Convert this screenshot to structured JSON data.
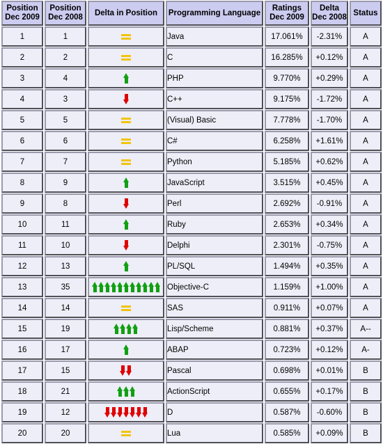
{
  "table": {
    "columns": [
      {
        "key": "pos2009",
        "line1": "Position",
        "line2": "Dec 2009"
      },
      {
        "key": "pos2008",
        "line1": "Position",
        "line2": "Dec 2008"
      },
      {
        "key": "delta_pos",
        "line1": "Delta in Position",
        "line2": ""
      },
      {
        "key": "language",
        "line1": "Programming Language",
        "line2": ""
      },
      {
        "key": "ratings",
        "line1": "Ratings",
        "line2": "Dec 2009"
      },
      {
        "key": "delta",
        "line1": "Delta",
        "line2": "Dec 2008"
      },
      {
        "key": "status",
        "line1": "Status",
        "line2": ""
      }
    ],
    "icons": {
      "up": "arrow-up-icon",
      "down": "arrow-down-icon",
      "equal": "equals-icon"
    },
    "colors": {
      "header_bg": "#ccccf0",
      "cell_bg": "#eeeef8",
      "border": "#9a9aad",
      "language_text": "#3333aa",
      "arrow_up": "#11a011",
      "arrow_down": "#e00000",
      "equals": "#f2c40a"
    },
    "rows": [
      {
        "pos2009": "1",
        "pos2008": "1",
        "delta_dir": "equal",
        "delta_count": 1,
        "language": "Java",
        "ratings": "17.061%",
        "delta": "-2.31%",
        "status": "A"
      },
      {
        "pos2009": "2",
        "pos2008": "2",
        "delta_dir": "equal",
        "delta_count": 1,
        "language": "C",
        "ratings": "16.285%",
        "delta": "+0.12%",
        "status": "A"
      },
      {
        "pos2009": "3",
        "pos2008": "4",
        "delta_dir": "up",
        "delta_count": 1,
        "language": "PHP",
        "ratings": "9.770%",
        "delta": "+0.29%",
        "status": "A"
      },
      {
        "pos2009": "4",
        "pos2008": "3",
        "delta_dir": "down",
        "delta_count": 1,
        "language": "C++",
        "ratings": "9.175%",
        "delta": "-1.72%",
        "status": "A"
      },
      {
        "pos2009": "5",
        "pos2008": "5",
        "delta_dir": "equal",
        "delta_count": 1,
        "language": "(Visual) Basic",
        "ratings": "7.778%",
        "delta": "-1.70%",
        "status": "A"
      },
      {
        "pos2009": "6",
        "pos2008": "6",
        "delta_dir": "equal",
        "delta_count": 1,
        "language": "C#",
        "ratings": "6.258%",
        "delta": "+1.61%",
        "status": "A"
      },
      {
        "pos2009": "7",
        "pos2008": "7",
        "delta_dir": "equal",
        "delta_count": 1,
        "language": "Python",
        "ratings": "5.185%",
        "delta": "+0.62%",
        "status": "A"
      },
      {
        "pos2009": "8",
        "pos2008": "9",
        "delta_dir": "up",
        "delta_count": 1,
        "language": "JavaScript",
        "ratings": "3.515%",
        "delta": "+0.45%",
        "status": "A"
      },
      {
        "pos2009": "9",
        "pos2008": "8",
        "delta_dir": "down",
        "delta_count": 1,
        "language": "Perl",
        "ratings": "2.692%",
        "delta": "-0.91%",
        "status": "A"
      },
      {
        "pos2009": "10",
        "pos2008": "11",
        "delta_dir": "up",
        "delta_count": 1,
        "language": "Ruby",
        "ratings": "2.653%",
        "delta": "+0.34%",
        "status": "A"
      },
      {
        "pos2009": "11",
        "pos2008": "10",
        "delta_dir": "down",
        "delta_count": 1,
        "language": "Delphi",
        "ratings": "2.301%",
        "delta": "-0.75%",
        "status": "A"
      },
      {
        "pos2009": "12",
        "pos2008": "13",
        "delta_dir": "up",
        "delta_count": 1,
        "language": "PL/SQL",
        "ratings": "1.494%",
        "delta": "+0.35%",
        "status": "A"
      },
      {
        "pos2009": "13",
        "pos2008": "35",
        "delta_dir": "up",
        "delta_count": 11,
        "language": "Objective-C",
        "ratings": "1.159%",
        "delta": "+1.00%",
        "status": "A"
      },
      {
        "pos2009": "14",
        "pos2008": "14",
        "delta_dir": "equal",
        "delta_count": 1,
        "language": "SAS",
        "ratings": "0.911%",
        "delta": "+0.07%",
        "status": "A"
      },
      {
        "pos2009": "15",
        "pos2008": "19",
        "delta_dir": "up",
        "delta_count": 4,
        "language": "Lisp/Scheme",
        "ratings": "0.881%",
        "delta": "+0.37%",
        "status": "A--"
      },
      {
        "pos2009": "16",
        "pos2008": "17",
        "delta_dir": "up",
        "delta_count": 1,
        "language": "ABAP",
        "ratings": "0.723%",
        "delta": "+0.12%",
        "status": "A-"
      },
      {
        "pos2009": "17",
        "pos2008": "15",
        "delta_dir": "down",
        "delta_count": 2,
        "language": "Pascal",
        "ratings": "0.698%",
        "delta": "+0.01%",
        "status": "B"
      },
      {
        "pos2009": "18",
        "pos2008": "21",
        "delta_dir": "up",
        "delta_count": 3,
        "language": "ActionScript",
        "ratings": "0.655%",
        "delta": "+0.17%",
        "status": "B"
      },
      {
        "pos2009": "19",
        "pos2008": "12",
        "delta_dir": "down",
        "delta_count": 7,
        "language": "D",
        "ratings": "0.587%",
        "delta": "-0.60%",
        "status": "B"
      },
      {
        "pos2009": "20",
        "pos2008": "20",
        "delta_dir": "equal",
        "delta_count": 1,
        "language": "Lua",
        "ratings": "0.585%",
        "delta": "+0.09%",
        "status": "B"
      }
    ]
  }
}
